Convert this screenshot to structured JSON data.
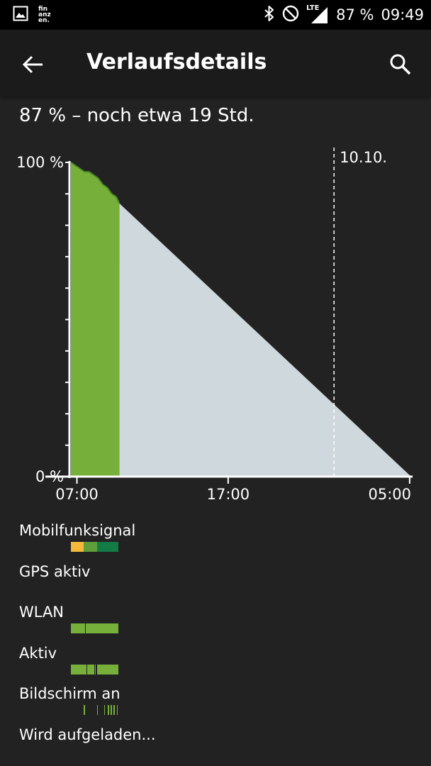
{
  "status_bar": {
    "left_icons": [
      "gallery-icon",
      "finanzen-app-icon"
    ],
    "finanzen_text": [
      "fin",
      "anz",
      "en."
    ],
    "lte_label": "LTE",
    "battery_text": "87 %",
    "time": "09:49"
  },
  "app_bar": {
    "title": "Verlaufsdetails",
    "back_icon": "arrow-left-icon",
    "search_icon": "search-icon"
  },
  "summary": "87 % – noch etwa 19 Std.",
  "chart_data": {
    "type": "area",
    "title": "",
    "y_tick_labels": [
      "100 %",
      "0 %"
    ],
    "x_tick_labels": [
      "07:00",
      "17:00",
      "05:00"
    ],
    "ylim": [
      0,
      100
    ],
    "xlim_hours": [
      6.6,
      29.1
    ],
    "x_ticks_hours": [
      7,
      17,
      29
    ],
    "date_marker": {
      "label": "10.10.",
      "x_hours": 24.0
    },
    "series": [
      {
        "kind": "recorded",
        "color": "#76b03a",
        "x_hours": [
          6.6,
          6.9,
          7.2,
          7.5,
          7.8,
          8.1,
          8.4,
          8.7,
          9.0,
          9.3,
          9.6,
          9.8
        ],
        "y": [
          100,
          99,
          98,
          97,
          97,
          96,
          95,
          93,
          92,
          90,
          89,
          87
        ]
      },
      {
        "kind": "predicted",
        "color": "#cfd8dc",
        "x_hours": [
          9.8,
          29.1
        ],
        "y": [
          87,
          0
        ]
      }
    ]
  },
  "signal_rows": [
    {
      "label": "Mobilfunksignal",
      "segments": [
        {
          "start": 0.0,
          "end": 0.27,
          "color": "#f4b93a"
        },
        {
          "start": 0.27,
          "end": 0.55,
          "color": "#5f9e3a"
        },
        {
          "start": 0.55,
          "end": 1.0,
          "color": "#137b45"
        }
      ]
    },
    {
      "label": "GPS aktiv",
      "segments": []
    },
    {
      "label": "WLAN",
      "segments": [
        {
          "start": 0.0,
          "end": 0.3,
          "color": "#76b03a"
        },
        {
          "start": 0.32,
          "end": 1.0,
          "color": "#76b03a"
        }
      ]
    },
    {
      "label": "Aktiv",
      "segments": [
        {
          "start": 0.0,
          "end": 0.33,
          "color": "#76b03a"
        },
        {
          "start": 0.35,
          "end": 0.49,
          "color": "#76b03a"
        },
        {
          "start": 0.51,
          "end": 0.53,
          "color": "#76b03a"
        },
        {
          "start": 0.55,
          "end": 1.0,
          "color": "#76b03a"
        }
      ]
    },
    {
      "label": "Bildschirm an",
      "segments": [
        {
          "start": 0.27,
          "end": 0.3,
          "color": "#76b03a"
        },
        {
          "start": 0.55,
          "end": 0.57,
          "color": "#76b03a"
        },
        {
          "start": 0.7,
          "end": 0.72,
          "color": "#76b03a"
        },
        {
          "start": 0.78,
          "end": 0.8,
          "color": "#76b03a"
        },
        {
          "start": 0.84,
          "end": 0.86,
          "color": "#76b03a"
        },
        {
          "start": 0.9,
          "end": 0.93,
          "color": "#76b03a"
        },
        {
          "start": 0.97,
          "end": 0.99,
          "color": "#76b03a"
        }
      ]
    },
    {
      "label": "Wird aufgeladen...",
      "segments": []
    }
  ]
}
